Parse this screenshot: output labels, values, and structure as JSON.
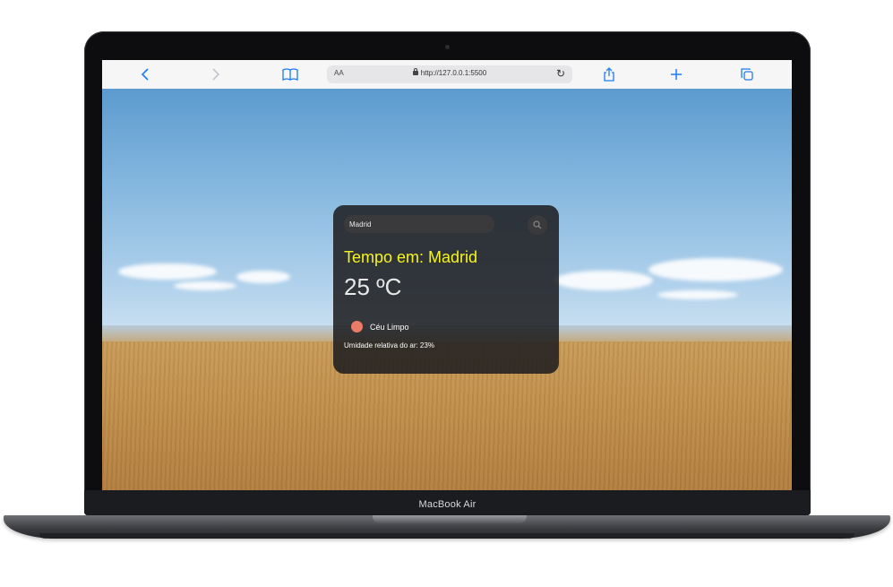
{
  "device": {
    "model_label": "MacBook Air"
  },
  "browser": {
    "toolbar": {
      "back_icon": "chevron-left-icon",
      "forward_icon": "chevron-right-icon",
      "reader_text_size": "AA",
      "url": "http://127.0.0.1:5500",
      "accent_color": "#1c7cf4"
    }
  },
  "weather": {
    "search": {
      "value": "Madrid"
    },
    "title": "Tempo em: Madrid",
    "temperature": "25 ºC",
    "description": "Céu Limpo",
    "humidity": "Umidade relativa do ar: 23%",
    "title_color": "#f5f51e",
    "status_dot_color": "#ea7b67"
  }
}
